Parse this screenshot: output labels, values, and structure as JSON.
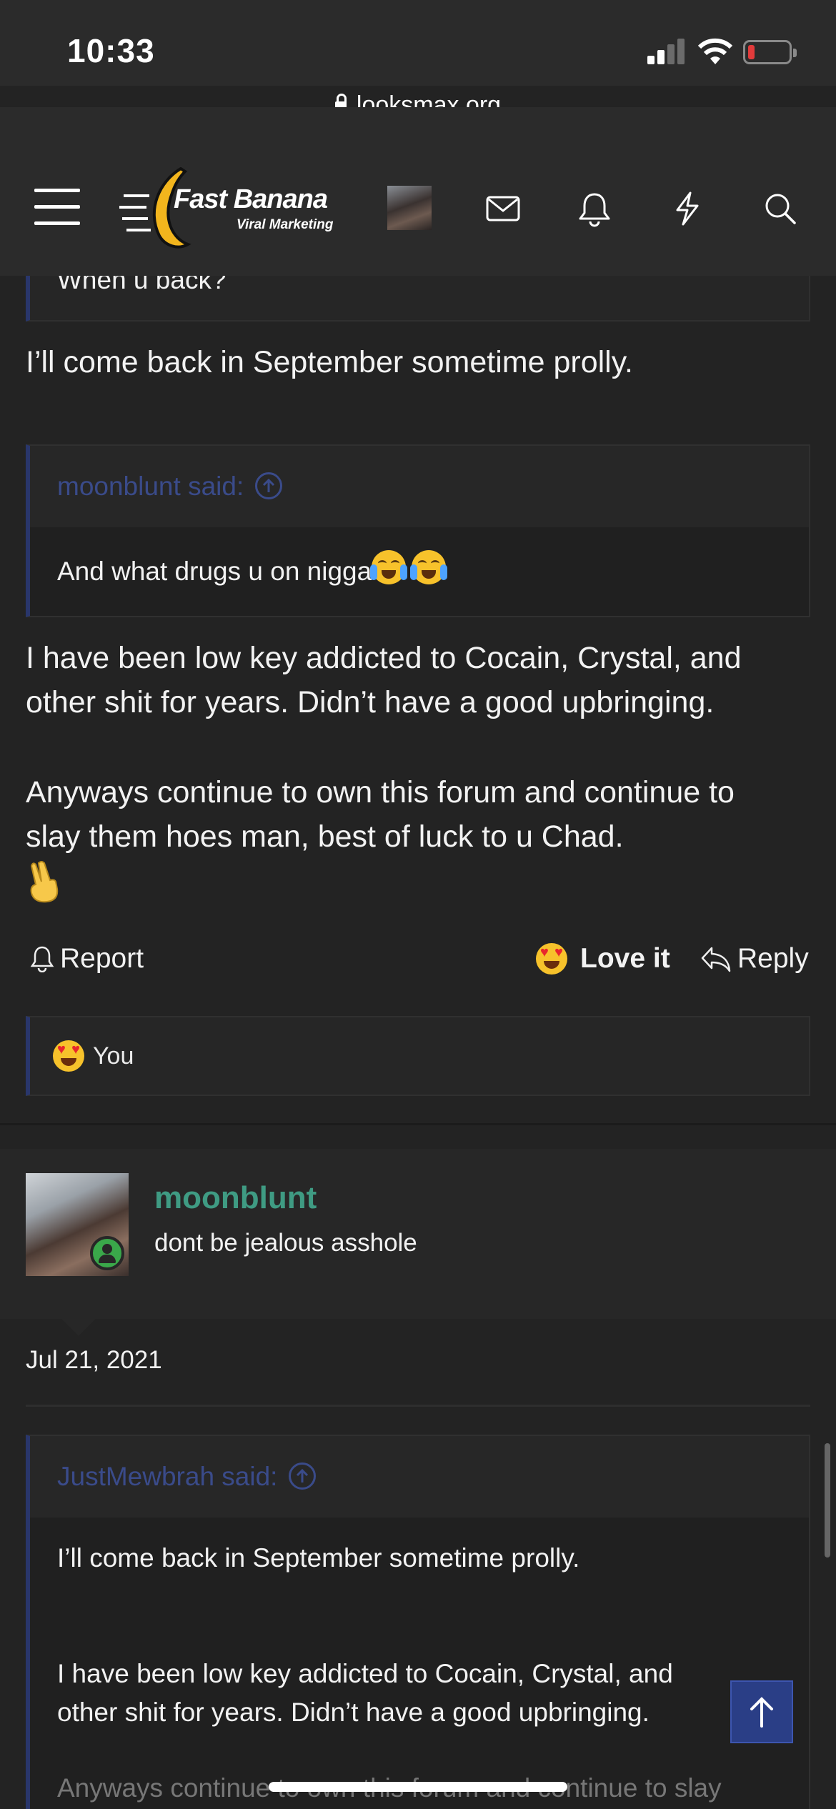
{
  "status_bar": {
    "time": "10:33",
    "url": "looksmax.org"
  },
  "nav": {
    "logo_name": "Fast Banana",
    "logo_sub": "Viral Marketing",
    "icons": [
      "menu-icon",
      "mail-icon",
      "bell-icon",
      "lightning-icon",
      "search-icon"
    ]
  },
  "post": {
    "quote_tail": "When u back?",
    "reply1": "I’ll come back in September sometime prolly.",
    "quote2": {
      "author": "moonblunt said:",
      "text": "And what drugs u on nigga"
    },
    "reply2_line1": "I have been low key addicted to Cocain, Crystal, and",
    "reply2_line2": "other shit for years. Didn’t have a good upbringing.",
    "reply3_line1": "Anyways continue to own this forum and continue to",
    "reply3_line2": "slay them hoes man, best of luck to u Chad.",
    "actions": {
      "report": "Report",
      "love": "Love it",
      "reply": "Reply"
    },
    "reactions": "You"
  },
  "next_post": {
    "username": "moonblunt",
    "user_title": "dont be jealous asshole",
    "date": "Jul 21, 2021",
    "quote_author": "JustMewbrah said:",
    "quote_line1": "I’ll come back in September sometime prolly.",
    "quote_line2": "I have been low key addicted to Cocain, Crystal, and",
    "quote_line3": "other shit for years. Didn’t have a good upbringing.",
    "quote_line4": "Anyways continue to own this forum and continue to slay"
  },
  "colors": {
    "accent": "#29366b",
    "username": "#3f9b83",
    "background": "#232323"
  }
}
